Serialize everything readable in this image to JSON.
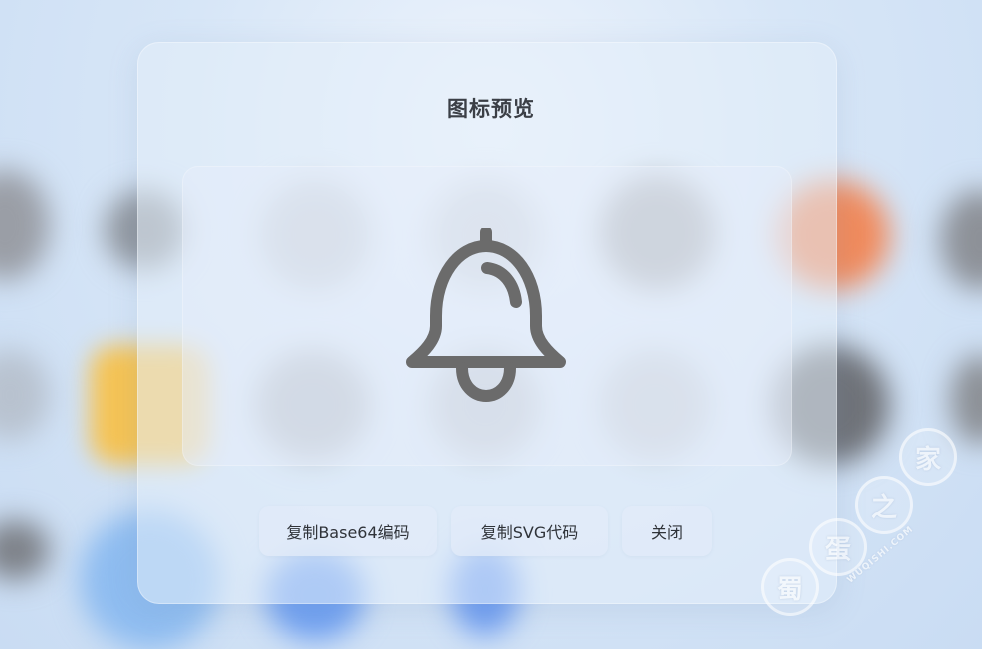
{
  "dialog": {
    "title": "图标预览",
    "preview_icon": "bell-icon"
  },
  "actions": {
    "copy_base64_label": "复制Base64编码",
    "copy_svg_label": "复制SVG代码",
    "close_label": "关闭"
  },
  "watermark": {
    "chars": [
      "蜀",
      "蛋",
      "之",
      "家"
    ],
    "text": "WUQISHI.COM"
  },
  "colors": {
    "icon_stroke": "#6b6b6b",
    "text": "#2f3339",
    "accent_background": "#d7e6f7"
  }
}
